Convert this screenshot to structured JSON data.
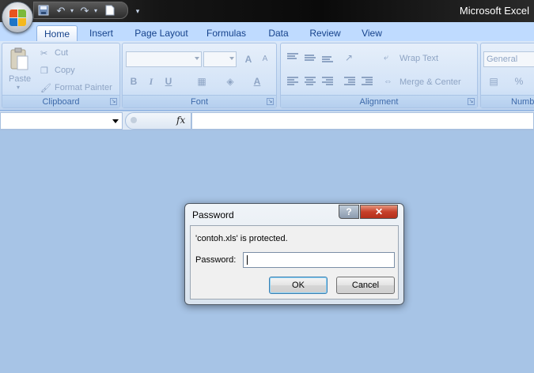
{
  "window": {
    "title": "Microsoft Excel"
  },
  "quick_access": {
    "save_icon": "save-icon",
    "undo_icon": "undo-icon",
    "redo_icon": "redo-icon",
    "new_icon": "new-document-icon"
  },
  "tabs": [
    {
      "label": "Home",
      "active": true
    },
    {
      "label": "Insert"
    },
    {
      "label": "Page Layout"
    },
    {
      "label": "Formulas"
    },
    {
      "label": "Data"
    },
    {
      "label": "Review"
    },
    {
      "label": "View"
    }
  ],
  "clipboard": {
    "paste": "Paste",
    "cut": "Cut",
    "copy": "Copy",
    "format_painter": "Format Painter",
    "label": "Clipboard"
  },
  "font": {
    "label": "Font",
    "bold": "B",
    "italic": "I",
    "underline": "U",
    "grow": "A",
    "shrink": "A"
  },
  "alignment": {
    "wrap_text": "Wrap Text",
    "merge_center": "Merge & Center",
    "label": "Alignment"
  },
  "number": {
    "format": "General",
    "label": "Numbe",
    "percent": "%"
  },
  "formula_bar": {
    "fx": "fx",
    "name_box": "",
    "formula": ""
  },
  "dialog": {
    "title": "Password",
    "help": "?",
    "close": "✕",
    "message": "'contoh.xls' is protected.",
    "password_label": "Password:",
    "password_value": "",
    "ok": "OK",
    "cancel": "Cancel"
  },
  "colors": {
    "workspace": "#a7c4e6",
    "ribbon": "#bfdbff",
    "titlebar": "#151515",
    "close": "#c6402a"
  }
}
